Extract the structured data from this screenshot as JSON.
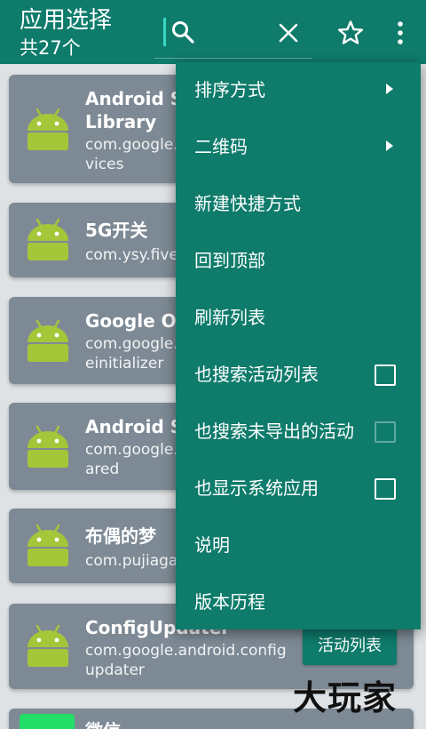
{
  "toolbar": {
    "title": "应用选择",
    "subtitle": "共27个",
    "search_value": ""
  },
  "apps": [
    {
      "name": "Android Se",
      "name2": "Library",
      "pkg": "com.google.",
      "pkg2": "vices"
    },
    {
      "name": "5G开关",
      "pkg": "com.ysy.five"
    },
    {
      "name": "Google On",
      "pkg": "com.google.",
      "pkg2": "einitializer"
    },
    {
      "name": "Android Sh",
      "pkg": "com.google.",
      "pkg2": "ared"
    },
    {
      "name": "布偶的梦",
      "pkg": "com.pujiaga"
    },
    {
      "name": "ConfigUpdater",
      "pkg": "com.google.android.config",
      "pkg2": "updater",
      "action": "活动列表"
    },
    {
      "name": "微信"
    }
  ],
  "menu": {
    "items": [
      {
        "label": "排序方式",
        "submenu": true
      },
      {
        "label": "二维码",
        "submenu": true
      },
      {
        "label": "新建快捷方式"
      },
      {
        "label": "回到顶部"
      },
      {
        "label": "刷新列表"
      },
      {
        "label": "也搜索活动列表",
        "checkbox": true,
        "checked": false
      },
      {
        "label": "也搜索未导出的活动",
        "checkbox": true,
        "checked": false,
        "enabled": false
      },
      {
        "label": "也显示系统应用",
        "checkbox": true,
        "checked": false
      },
      {
        "label": "说明"
      },
      {
        "label": "版本历程"
      }
    ]
  },
  "watermark": "大玩家",
  "colors": {
    "primary": "#0e7b6b",
    "card": "#7d8a95",
    "android_green": "#a4c639",
    "background": "#dfe2e4"
  },
  "icons": [
    "search-icon",
    "clear-icon",
    "star-icon",
    "more-vert-icon",
    "android-icon",
    "chevron-right-icon"
  ]
}
